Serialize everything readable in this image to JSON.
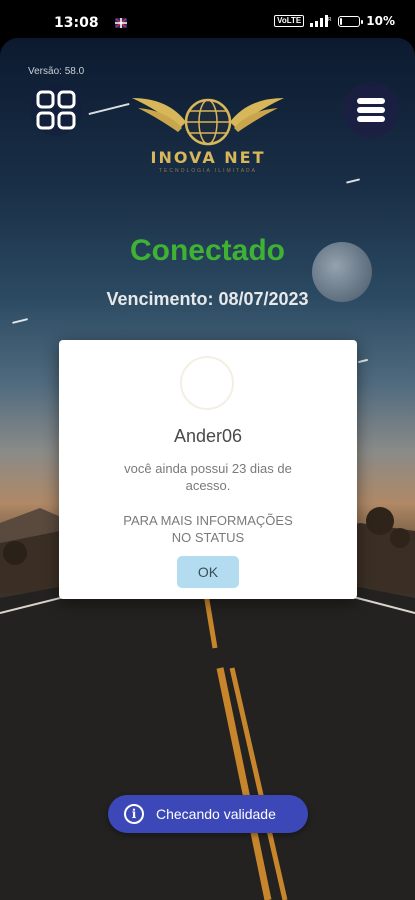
{
  "statusbar": {
    "time": "13:08",
    "volte_label": "VoLTE",
    "battery_percent": "10%",
    "battery_level": 0.1,
    "icons": [
      "notification-icon",
      "signal-icon",
      "battery-icon"
    ]
  },
  "app": {
    "version": "Versão: 58.0",
    "logo_name": "INOVA NET",
    "logo_tagline": "TECNOLOGIA ILIMITADA",
    "status": "Conectado",
    "expiry": "Vencimento: 08/07/2023",
    "colors": {
      "status": "#3fb233",
      "logo_gold": "#d8b65a",
      "toast": "#3c48b8",
      "ok_button": "#b4dcf0"
    }
  },
  "dialog": {
    "username": "Ander06",
    "message": "você ainda possui 23 dias de acesso.",
    "info": "PARA MAIS INFORMAÇÕES NO STATUS",
    "ok_label": "OK"
  },
  "toast": {
    "icon": "info-icon",
    "text": "Checando validade"
  }
}
